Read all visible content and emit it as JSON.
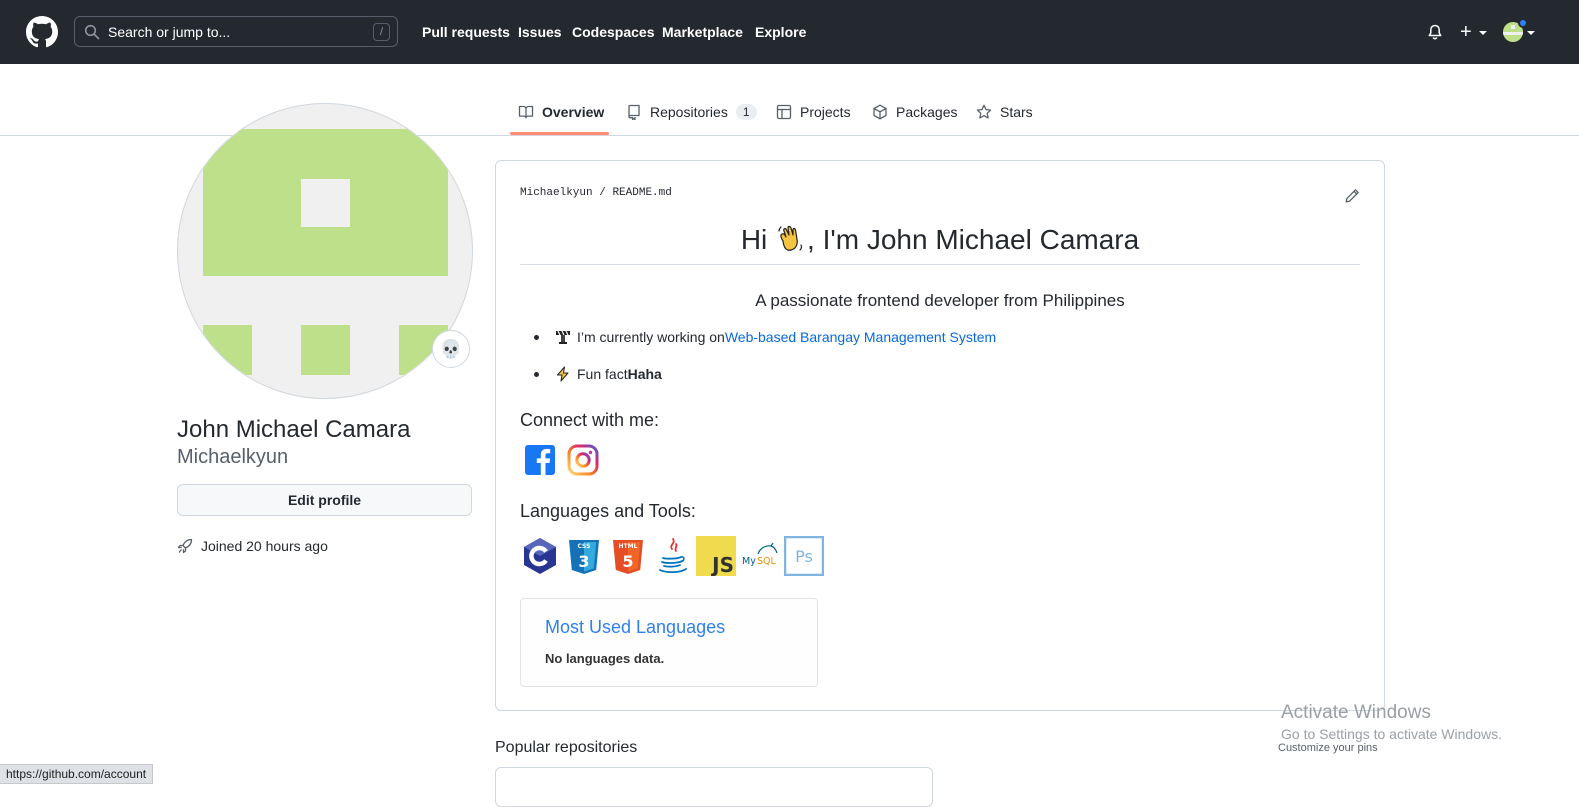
{
  "topbar": {
    "search_placeholder": "Search or jump to...",
    "search_shortcut": "/",
    "nav": [
      "Pull requests",
      "Issues",
      "Codespaces",
      "Marketplace",
      "Explore"
    ],
    "plus": "+"
  },
  "tabs": {
    "overview": "Overview",
    "repositories": "Repositories",
    "repositories_count": "1",
    "projects": "Projects",
    "packages": "Packages",
    "stars": "Stars"
  },
  "profile": {
    "status_emoji": "💀",
    "full_name": "John Michael Camara",
    "username": "Michaelkyun",
    "edit_button": "Edit profile",
    "joined": "Joined 20 hours ago"
  },
  "readme": {
    "path_user": "Michaelkyun",
    "path_sep": " / ",
    "path_file": "README.md",
    "title_prefix": "Hi ",
    "title_suffix": ", I'm John Michael Camara",
    "subtitle": "A passionate frontend developer from Philippines",
    "bullet1_text": "I’m currently working on ",
    "bullet1_link": "Web-based Barangay Management System",
    "bullet2_text": "Fun fact ",
    "bullet2_bold": "Haha",
    "connect_heading": "Connect with me:",
    "languages_heading": "Languages and Tools:",
    "tools": [
      "c",
      "css3",
      "html5",
      "java",
      "javascript",
      "mysql",
      "photoshop"
    ],
    "lang_card_title": "Most Used Languages",
    "lang_card_body": "No languages data."
  },
  "popular": "Popular repositories",
  "windows_watermark": {
    "line1": "Activate Windows",
    "line2": "Go to Settings to activate Windows.",
    "line3": "Customize your pins"
  },
  "status_url": "https://github.com/account",
  "colors": {
    "header_bg": "#24292f",
    "accent_underline": "#fd8c73",
    "link": "#0969da",
    "avatar_green": "#bfe08a"
  }
}
